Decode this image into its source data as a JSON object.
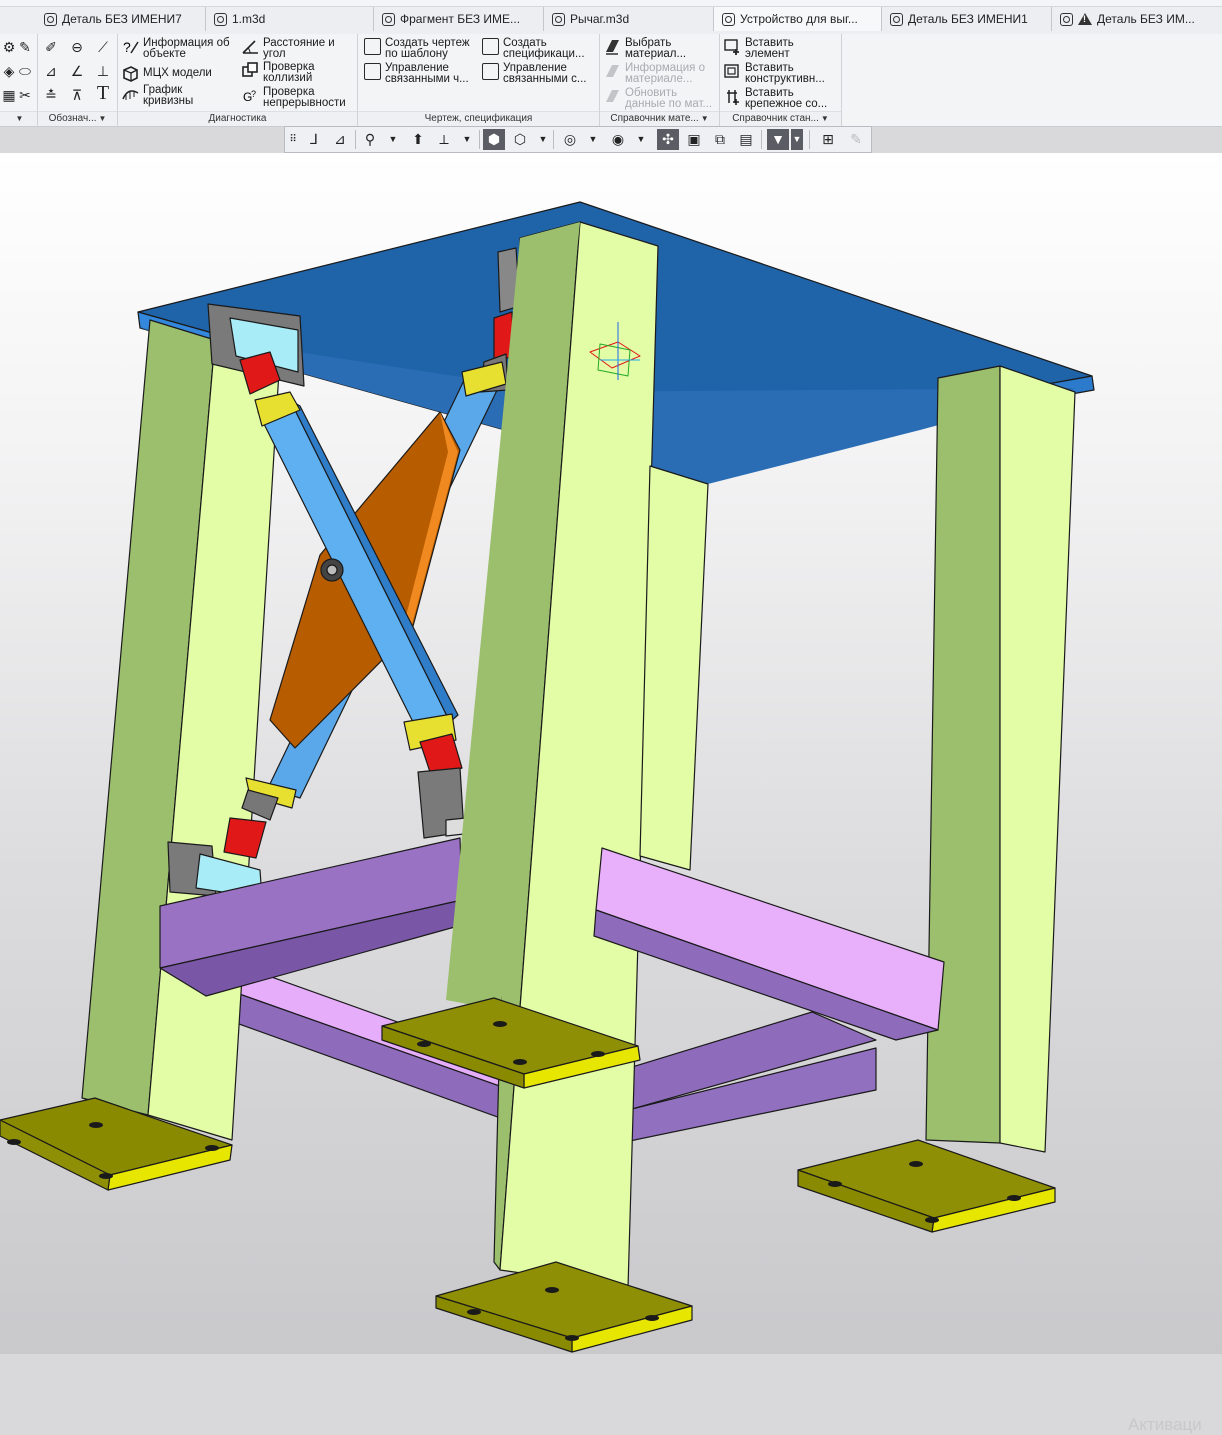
{
  "tabs": [
    {
      "label": "Деталь БЕЗ ИМЕНИ7",
      "icon": "part-document-icon"
    },
    {
      "label": "1.m3d",
      "icon": "part-document-icon"
    },
    {
      "label": "Фрагмент БЕЗ ИМЕ...",
      "icon": "fragment-document-icon"
    },
    {
      "label": "Рычаг.m3d",
      "icon": "part-document-icon"
    },
    {
      "label": "Устройство для выг...",
      "icon": "assembly-document-icon"
    },
    {
      "label": "Деталь БЕЗ ИМЕНИ1",
      "icon": "part-document-icon"
    },
    {
      "label": "Деталь БЕЗ ИМ...",
      "icon": "warning-icon"
    }
  ],
  "ribbon": {
    "groups": [
      {
        "label": "Обознач...",
        "dropdown": true
      },
      {
        "label": "Диагностика",
        "dropdown": false
      },
      {
        "label": "Чертеж, спецификация",
        "dropdown": false
      },
      {
        "label": "Справочник мате...",
        "dropdown": true
      },
      {
        "label": "Справочник стан...",
        "dropdown": true
      }
    ],
    "diagnostics": [
      {
        "line1": "Информация об",
        "line2": "объекте",
        "icon": "info-object-icon"
      },
      {
        "line1": "МЦХ модели",
        "line2": "",
        "icon": "mass-properties-icon"
      },
      {
        "line1": "График",
        "line2": "кривизны",
        "icon": "curvature-graph-icon"
      },
      {
        "line1": "Расстояние и",
        "line2": "угол",
        "icon": "distance-angle-icon"
      },
      {
        "line1": "Проверка",
        "line2": "коллизий",
        "icon": "collision-check-icon"
      },
      {
        "line1": "Проверка",
        "line2": "непрерывности",
        "icon": "continuity-check-icon"
      }
    ],
    "drawing": [
      {
        "line1": "Создать чертеж",
        "line2": "по шаблону",
        "icon": "drawing-template-icon"
      },
      {
        "line1": "Управление",
        "line2": "связанными ч...",
        "icon": "linked-drawings-icon"
      },
      {
        "line1": "Создать",
        "line2": "спецификаци...",
        "icon": "create-spec-icon"
      },
      {
        "line1": "Управление",
        "line2": "связанными с...",
        "icon": "linked-specs-icon"
      }
    ],
    "materials": [
      {
        "line1": "Выбрать",
        "line2": "материал...",
        "icon": "material-icon",
        "disabled": false
      },
      {
        "line1": "Информация о",
        "line2": "материале...",
        "icon": "material-info-icon",
        "disabled": true
      },
      {
        "line1": "Обновить",
        "line2": "данные по мат...",
        "icon": "material-update-icon",
        "disabled": true
      }
    ],
    "standard": [
      {
        "line1": "Вставить",
        "line2": "элемент",
        "icon": "insert-element-icon"
      },
      {
        "line1": "Вставить",
        "line2": "конструктивн...",
        "icon": "insert-structural-icon"
      },
      {
        "line1": "Вставить",
        "line2": "крепежное со...",
        "icon": "insert-fastener-icon"
      }
    ]
  },
  "watermark": "Активаци"
}
